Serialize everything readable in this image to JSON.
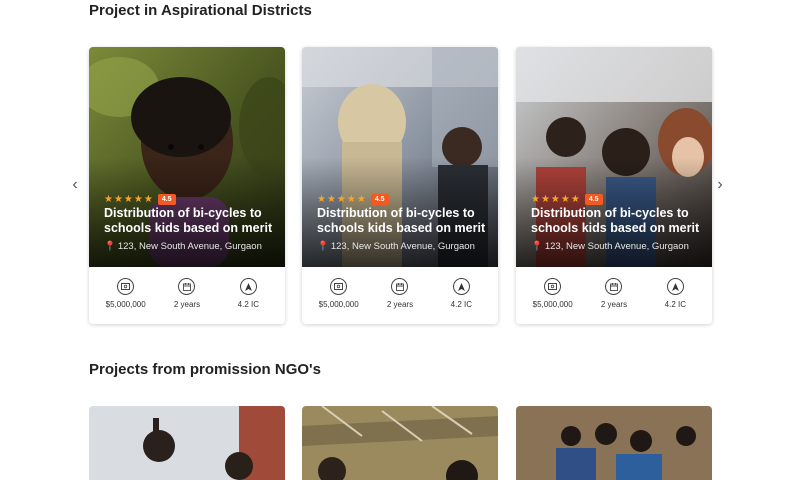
{
  "sections": {
    "aspirational_title": "Project in Aspirational Districts",
    "ngo_title": "Projects from promission NGO's"
  },
  "carousel": {
    "prev_icon": "chevron-left-icon",
    "next_icon": "chevron-right-icon"
  },
  "cards": [
    {
      "stars": "★★★★★",
      "rating": "4.5",
      "title": "Distribution of bi-cycles to schools kids based on merit",
      "location": "123, New South Avenue, Gurgaon",
      "budget": "$5,000,000",
      "duration": "2 years",
      "impact": "4.2 IC"
    },
    {
      "stars": "★★★★★",
      "rating": "4.5",
      "title": "Distribution of bi-cycles to schools kids based on merit",
      "location": "123, New South Avenue, Gurgaon",
      "budget": "$5,000,000",
      "duration": "2 years",
      "impact": "4.2 IC"
    },
    {
      "stars": "★★★★★",
      "rating": "4.5",
      "title": "Distribution of bi-cycles to schools kids based on merit",
      "location": "123, New South Avenue, Gurgaon",
      "budget": "$5,000,000",
      "duration": "2 years",
      "impact": "4.2 IC"
    }
  ],
  "colors": {
    "accent": "#f15a22",
    "star": "#f4a52a"
  },
  "icons": {
    "budget": "money-icon",
    "duration": "calendar-icon",
    "impact": "navigation-arrow-icon",
    "location": "map-pin-icon"
  }
}
